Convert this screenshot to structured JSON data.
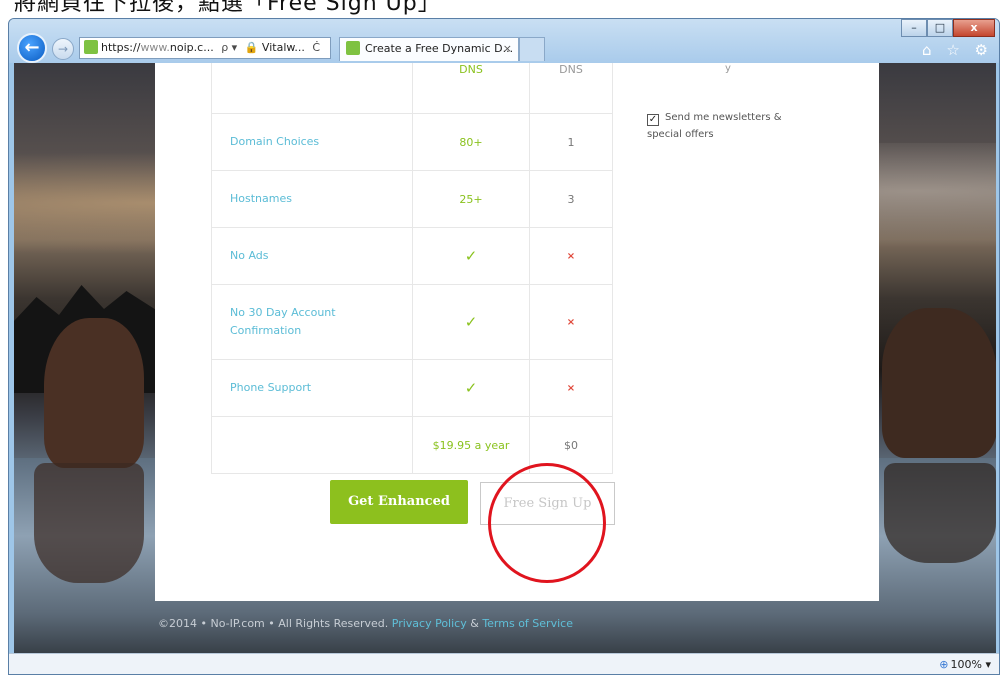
{
  "caption": {
    "text": "將網頁往下拉後，點選「Free Sign Up」"
  },
  "window": {
    "controls": {
      "minimize": "–",
      "maximize": "□",
      "close": "x"
    }
  },
  "nav": {
    "back_icon": "back-arrow-icon",
    "forward_icon": "forward-arrow-icon"
  },
  "address": {
    "url_prefix": "https://",
    "url_dim": "www.",
    "url_host": "noip.c...",
    "search_glyph": "ρ ▾",
    "site_identity": "Vitalw...",
    "refresh_glyph": "Ċ"
  },
  "tab": {
    "title": "Create a Free Dynamic D...",
    "close": "×"
  },
  "toolbar_icons": "⌂ ☆ ⚙",
  "table": {
    "header": {
      "enhanced": "DNS",
      "free": "DNS"
    },
    "rows": [
      {
        "feature": "Domain Choices",
        "enhanced": "80+",
        "free": "1"
      },
      {
        "feature": "Hostnames",
        "enhanced": "25+",
        "free": "3"
      },
      {
        "feature": "No Ads",
        "enhanced": "✓",
        "free": "×"
      },
      {
        "feature": "No 30 Day Account Confirmation",
        "enhanced": "✓",
        "free": "×"
      },
      {
        "feature": "Phone Support",
        "enhanced": "✓",
        "free": "×"
      },
      {
        "feature": "",
        "enhanced": "$19.95 a year",
        "free": "$0"
      }
    ]
  },
  "signup_side": {
    "partial_text": "y",
    "newsletter_checked": "✓",
    "newsletter_label": "Send me newsletters & special offers"
  },
  "buttons": {
    "enhanced": "Get Enhanced",
    "free": "Free Sign Up"
  },
  "footer": {
    "copyright": "©2014 • No-IP.com • All Rights Reserved.",
    "privacy": "Privacy Policy",
    "amp": " & ",
    "terms": "Terms of Service"
  },
  "status": {
    "zoom": "100%",
    "zoom_arrow": "▾"
  },
  "colors": {
    "accent_green": "#8dc01e",
    "link_blue": "#5bbcd6",
    "annotation_red": "#e0141e"
  }
}
